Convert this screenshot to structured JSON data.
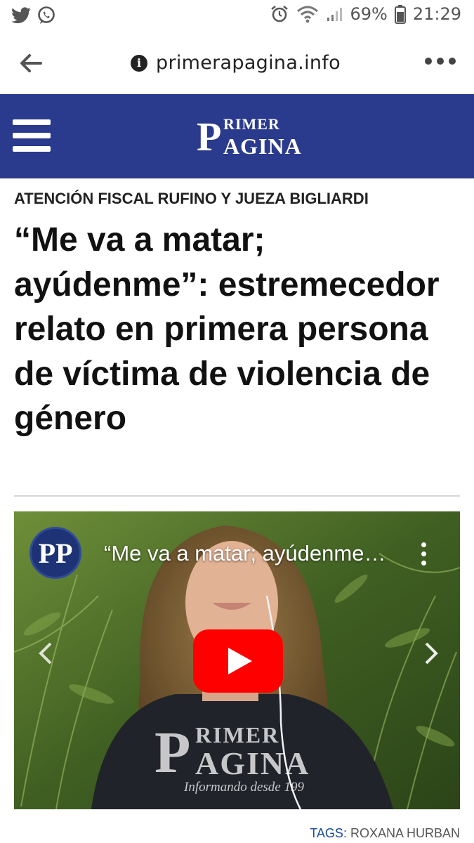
{
  "status_bar": {
    "left_icons": [
      "twitter-icon",
      "whatsapp-icon"
    ],
    "right_icons": [
      "alarm-icon",
      "wifi-icon",
      "signal-icon",
      "battery-icon"
    ],
    "battery_percent": "69%",
    "time": "21:29"
  },
  "browser": {
    "url": "primerapagina.info",
    "back_icon": "arrow-left-icon",
    "info_icon": "info-icon",
    "menu_icon": "more-dots-icon"
  },
  "site": {
    "logo_first_letter": "P",
    "logo_line1": "RIMER",
    "logo_line2": "AGINA",
    "header_color": "#2a3a8c",
    "menu_icon": "hamburger-icon"
  },
  "article": {
    "kicker": "ATENCIÓN FISCAL RUFINO Y JUEZA BIGLIARDI",
    "headline": "“Me va a matar; ayúdenme”: estremecedor relato en primera persona de víctima de violencia de género"
  },
  "video": {
    "channel_logo_text": "PP",
    "title": "“Me va a matar; ayúdenme…",
    "watermark_first_letter": "P",
    "watermark_line1": "RIMER",
    "watermark_line2": "AGINA",
    "watermark_tagline": "Informando desde 199",
    "play_color": "#ff0000"
  },
  "tags": {
    "label": "TAGS:",
    "value": "ROXANA HURBAN"
  }
}
